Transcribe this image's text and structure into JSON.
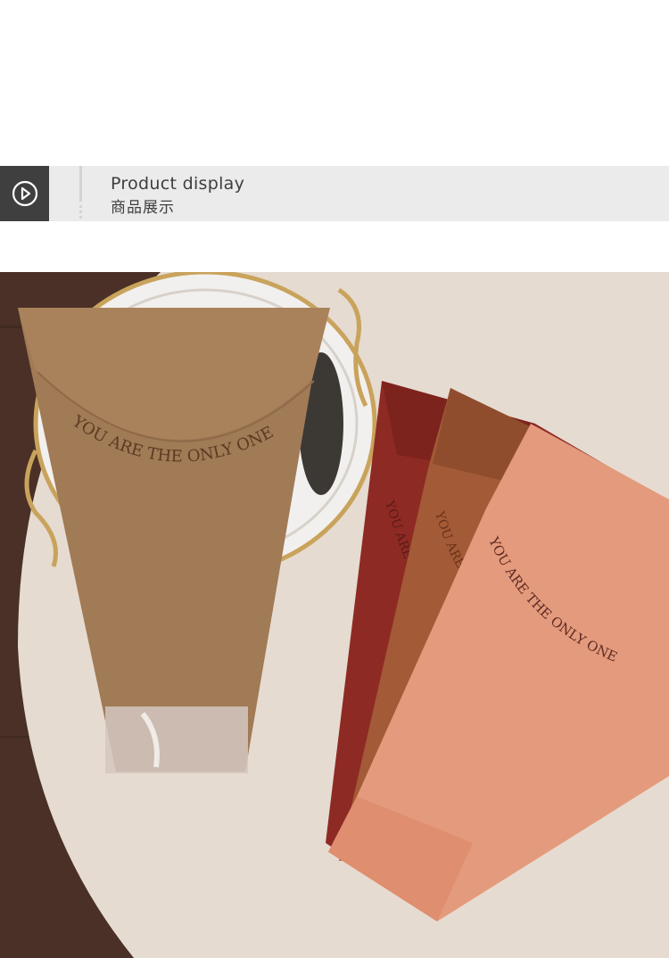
{
  "section_header": {
    "title_en": "Product display",
    "title_cn": "商品展示",
    "icon": "play-circle-icon",
    "accent_color": "#3f3f3f"
  },
  "photo": {
    "bag_text": "YOU ARE THE ONLY ONE",
    "bag_colors": [
      "#a17a56",
      "#8e2a24",
      "#a35a36",
      "#e49a7c"
    ]
  }
}
